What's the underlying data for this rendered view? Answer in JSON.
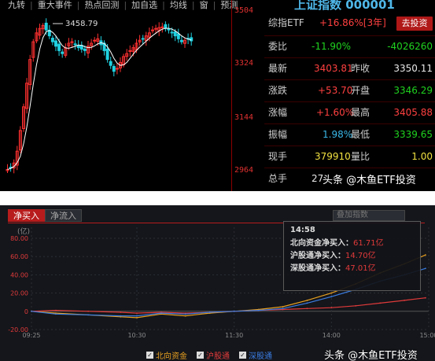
{
  "kline": {
    "toolbar": [
      "九转",
      "重大事件",
      "热点回测",
      "加自选",
      "均线",
      "窗",
      "预测"
    ],
    "price_labels": [
      "3504",
      "3324",
      "3144",
      "2964"
    ],
    "high_marker": "3458.79"
  },
  "quote": {
    "title": "上证指数 000001",
    "etf_label": "综指ETF",
    "etf_change": "+16.86%[3年]",
    "invest_button": "去投资",
    "rows": [
      {
        "l1": "委比",
        "v1": "-11.90%",
        "l2": "",
        "v2": "-4026260"
      },
      {
        "l1": "最新",
        "v1": "3403.81",
        "l2": "昨收",
        "v2": "3350.11"
      },
      {
        "l1": "涨跌",
        "v1": "+53.70",
        "l2": "开盘",
        "v2": "3346.29"
      },
      {
        "l1": "涨幅",
        "v1": "+1.60%",
        "l2": "最高",
        "v2": "3405.88"
      },
      {
        "l1": "振幅",
        "v1": "1.98%",
        "l2": "最低",
        "v2": "3339.65"
      },
      {
        "l1": "现手",
        "v1": "379910",
        "l2": "量比",
        "v2": "1.00"
      },
      {
        "l1": "总手",
        "v1": "27",
        "l2": "",
        "v2": ""
      }
    ]
  },
  "flow": {
    "tabs": [
      "净买入",
      "净流入"
    ],
    "unit": "(亿)",
    "dropdown": "叠加指数",
    "colors": {
      "north": "#e8a020",
      "sh": "#e03a3a",
      "sz": "#3a7be0"
    },
    "tooltip": {
      "time": "14:58",
      "rows": [
        {
          "label": "北向资金净买入：",
          "value": "61.71亿"
        },
        {
          "label": "沪股通净买入：",
          "value": "14.70亿"
        },
        {
          "label": "深股通净买入：",
          "value": "47.01亿"
        }
      ]
    },
    "legend": [
      "北向资金",
      "沪股通",
      "深股通"
    ]
  },
  "chart_data": {
    "type": "line",
    "title": "",
    "ylabel": "(亿)",
    "ylim": [
      -20,
      80
    ],
    "yticks": [
      "80.00",
      "60.00",
      "40.00",
      "20.00",
      "0",
      "-20.00"
    ],
    "xticks": [
      "09:25",
      "10:30",
      "11:30",
      "14:00",
      "15:00"
    ],
    "x": [
      "09:25",
      "09:40",
      "10:00",
      "10:20",
      "10:30",
      "10:45",
      "11:00",
      "11:15",
      "11:30",
      "13:15",
      "13:30",
      "13:45",
      "14:00",
      "14:15",
      "14:30",
      "14:45",
      "14:58"
    ],
    "series": [
      {
        "name": "北向资金",
        "values": [
          0,
          -2,
          -4,
          -6,
          -7,
          -3,
          -5,
          -2,
          0,
          2,
          5,
          12,
          20,
          30,
          42,
          52,
          61.71
        ]
      },
      {
        "name": "沪股通",
        "values": [
          0,
          1,
          0,
          -1,
          -2,
          -1,
          -2,
          -1,
          0,
          1,
          2,
          3,
          4,
          6,
          9,
          12,
          14.7
        ]
      },
      {
        "name": "深股通",
        "values": [
          0,
          -3,
          -4,
          -5,
          -5,
          -2,
          -3,
          -1,
          0,
          1,
          3,
          9,
          16,
          24,
          33,
          40,
          47.01
        ]
      }
    ]
  },
  "watermarks": [
    "头条 @木鱼ETF投资",
    "头条 @木鱼ETF投资"
  ]
}
